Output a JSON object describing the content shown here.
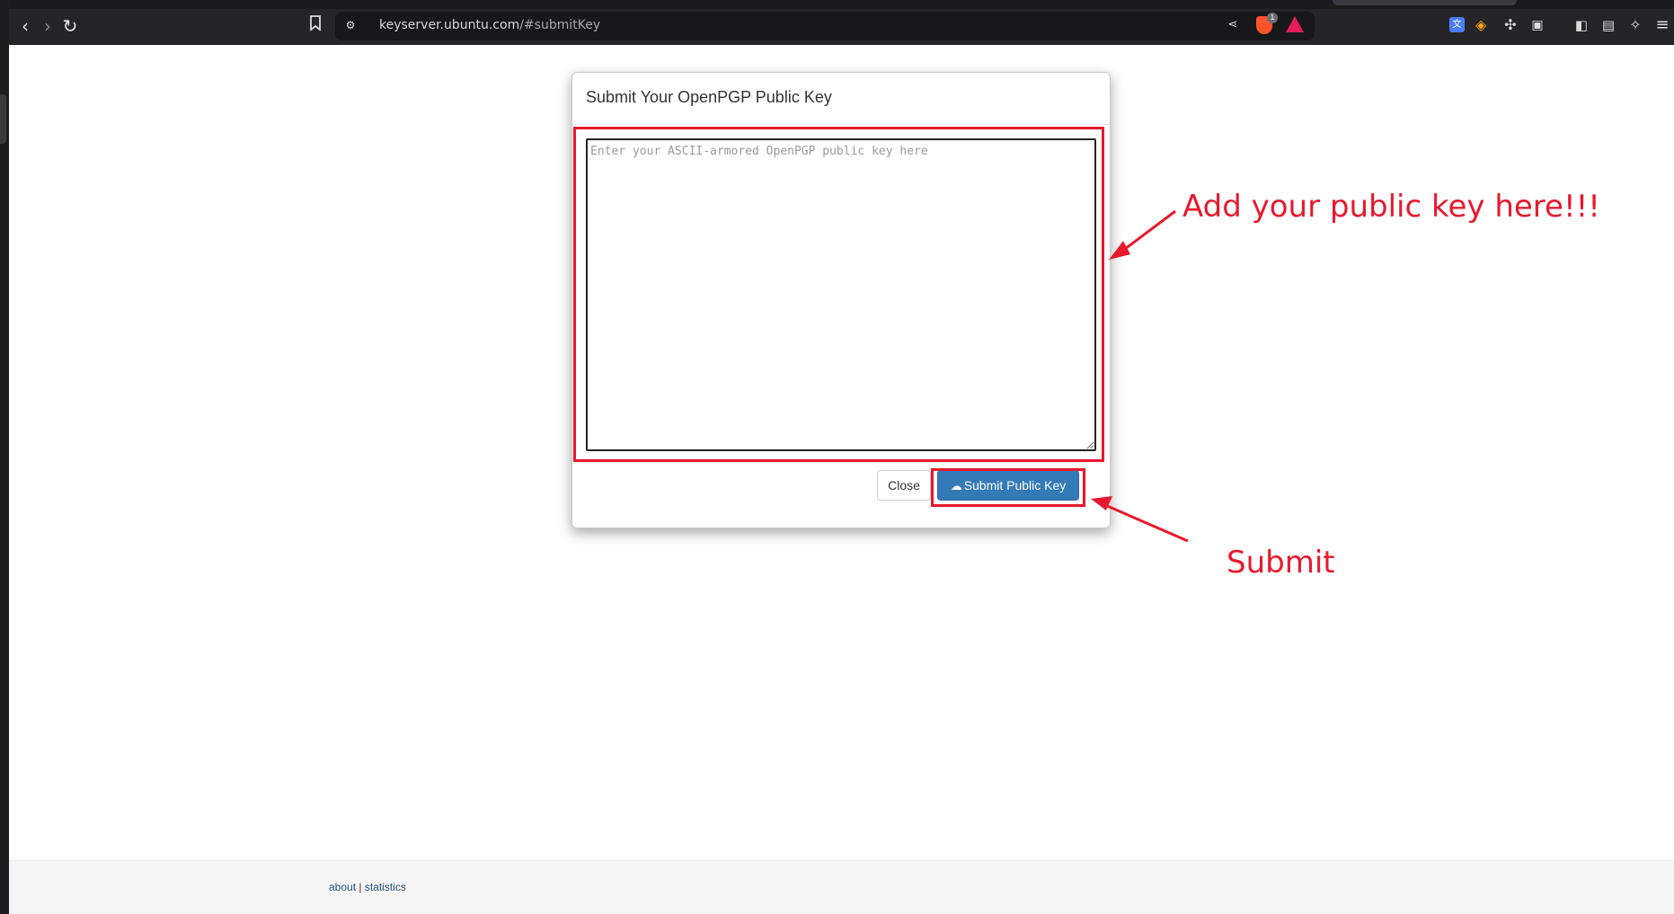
{
  "browser": {
    "url_host": "keyserver.ubuntu.com",
    "url_path": "/#submitKey",
    "brave_badge_count": "1",
    "icons": {
      "back": "arrow-left-icon",
      "forward": "arrow-right-icon",
      "reload": "reload-icon",
      "bookmark": "bookmark-icon",
      "site_info": "tune-icon",
      "share": "share-icon",
      "brave_shields": "brave-shield-icon",
      "rewards": "bat-triangle-icon",
      "translate": "translate-icon",
      "wallet": "wallet-icon",
      "extensions": "puzzle-icon",
      "reader": "reader-mode-icon",
      "sidebar": "sidebar-icon",
      "wallet_panel": "wallet-panel-icon",
      "leo": "leo-ai-icon",
      "menu": "hamburger-menu-icon"
    }
  },
  "modal": {
    "title": "Submit Your OpenPGP Public Key",
    "key_placeholder": "Enter your ASCII-armored OpenPGP public key here",
    "key_value": "",
    "close_label": "Close",
    "submit_label": "Submit Public Key",
    "submit_icon": "cloud-upload-icon"
  },
  "annotations": {
    "key_hint": "Add your public key here!!!",
    "submit_hint": "Submit",
    "color": "#e8192c"
  },
  "footer": {
    "about": "about",
    "separator": "|",
    "statistics": "statistics"
  },
  "colors": {
    "primary_button": "#337ab7",
    "annotation_red": "#e8192c",
    "chrome_bg": "#252529"
  }
}
